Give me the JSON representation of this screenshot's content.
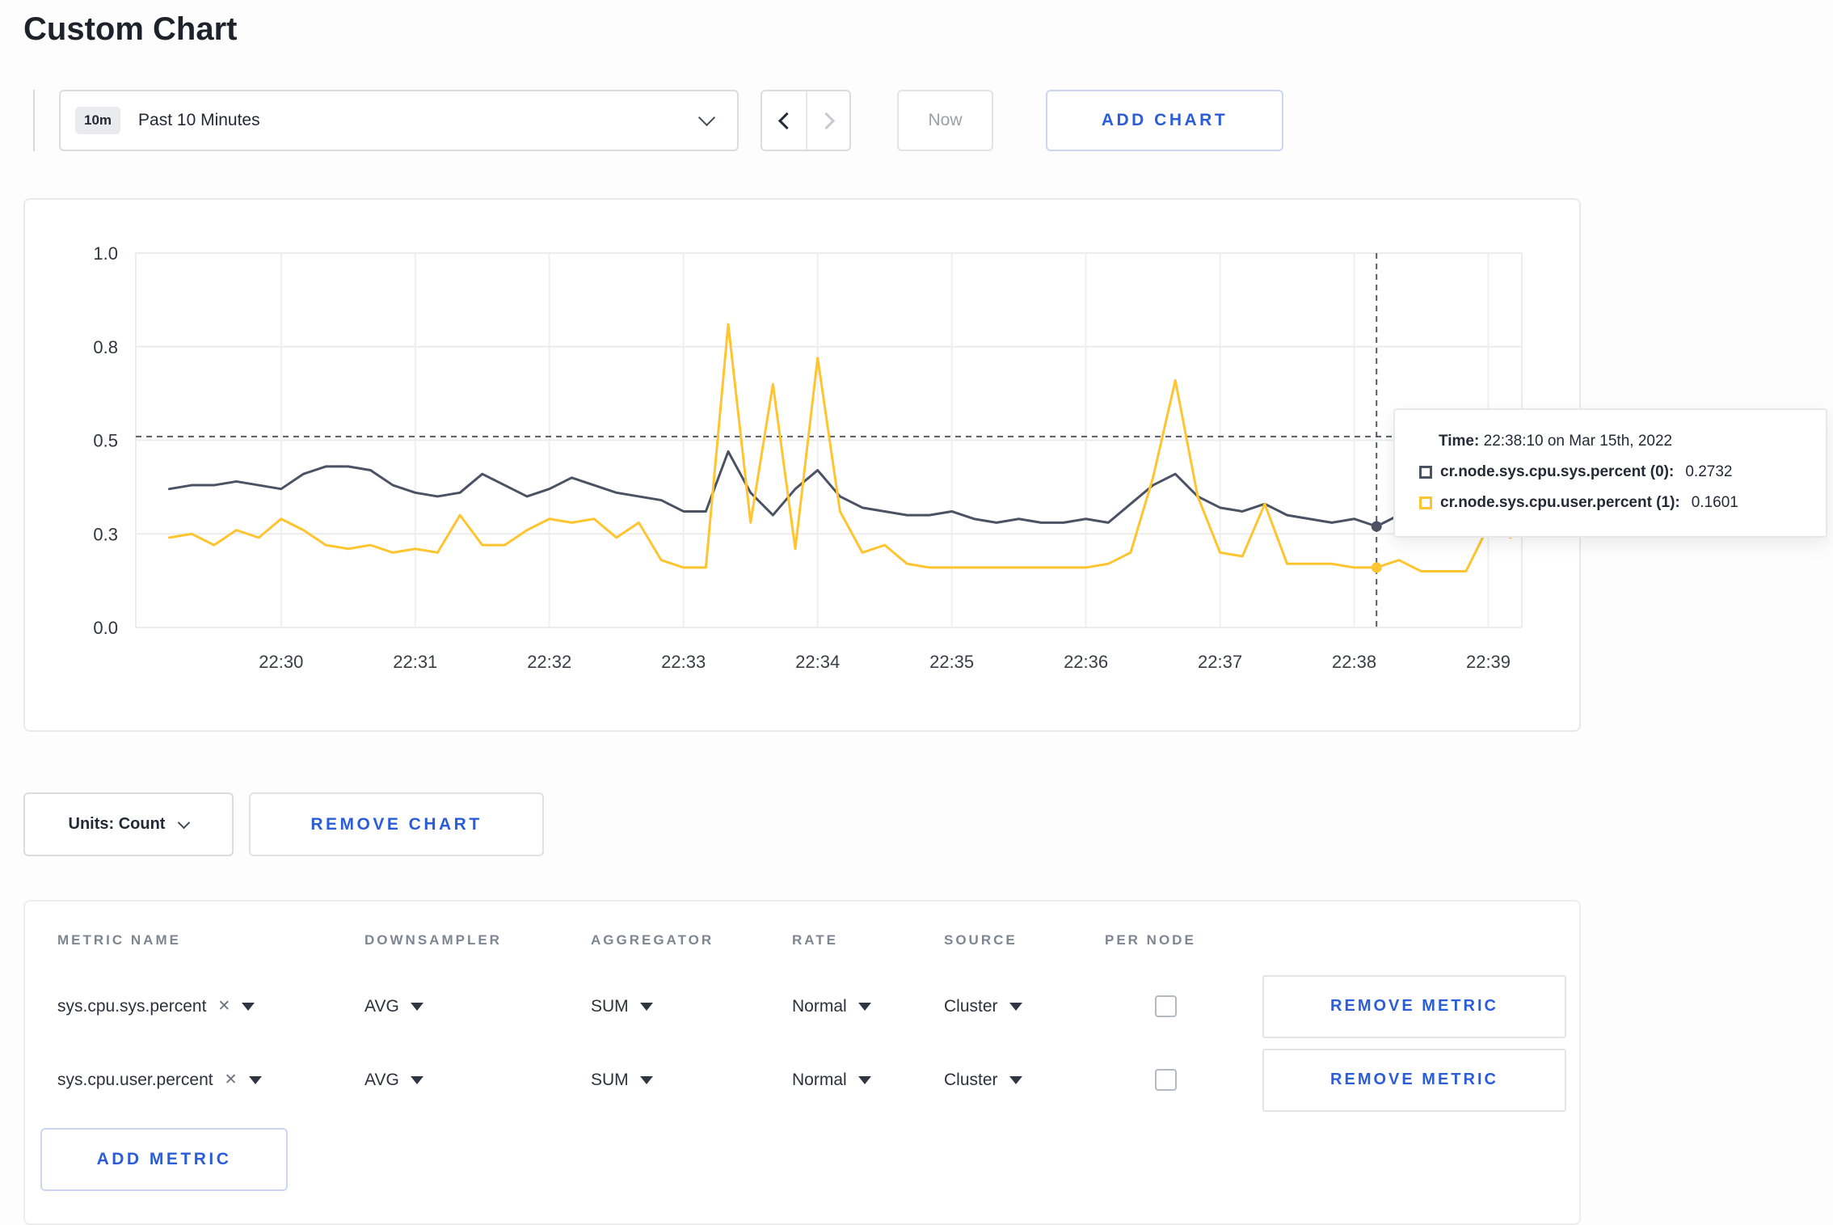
{
  "page": {
    "title": "Custom Chart"
  },
  "toolbar": {
    "time_range": {
      "badge": "10m",
      "label": "Past 10 Minutes"
    },
    "now_label": "Now",
    "add_chart_label": "ADD CHART"
  },
  "chart": {
    "units_label": "Units: Count",
    "remove_chart_label": "REMOVE CHART"
  },
  "tooltip": {
    "time_label": "Time:",
    "time_value": "22:38:10 on Mar 15th, 2022",
    "series": [
      {
        "label": "cr.node.sys.cpu.sys.percent (0):",
        "value": "0.2732"
      },
      {
        "label": "cr.node.sys.cpu.user.percent (1):",
        "value": "0.1601"
      }
    ]
  },
  "metrics_table": {
    "headers": [
      "METRIC NAME",
      "DOWNSAMPLER",
      "AGGREGATOR",
      "RATE",
      "SOURCE",
      "PER NODE"
    ],
    "rows": [
      {
        "metric": "sys.cpu.sys.percent",
        "downsampler": "AVG",
        "aggregator": "SUM",
        "rate": "Normal",
        "source": "Cluster",
        "per_node_checked": false,
        "remove_label": "REMOVE METRIC"
      },
      {
        "metric": "sys.cpu.user.percent",
        "downsampler": "AVG",
        "aggregator": "SUM",
        "rate": "Normal",
        "source": "Cluster",
        "per_node_checked": false,
        "remove_label": "REMOVE METRIC"
      }
    ],
    "add_metric_label": "ADD METRIC"
  },
  "icons": {
    "close": "✕"
  },
  "colors": {
    "accent_blue": "#2b5dd8",
    "series_sys": "#4a5263",
    "series_user": "#ffc530",
    "gridline": "#ececec",
    "crosshair": "#565b64"
  },
  "chart_data": {
    "type": "line",
    "title": "",
    "xlabel": "",
    "ylabel": "",
    "ylim": [
      0,
      1
    ],
    "grid": true,
    "legend_position": "tooltip",
    "x_tick_labels": [
      "22:30",
      "22:31",
      "22:32",
      "22:33",
      "22:34",
      "22:35",
      "22:36",
      "22:37",
      "22:38",
      "22:39"
    ],
    "y_ticks": [
      {
        "value": 0,
        "label": "0.0"
      },
      {
        "value": 0.25,
        "label": "0.3"
      },
      {
        "value": 0.5,
        "label": "0.5"
      },
      {
        "value": 0.75,
        "label": "0.8"
      },
      {
        "value": 1,
        "label": "1.0"
      }
    ],
    "crosshair": {
      "time": "22:38:10",
      "value": 0.51
    },
    "x_times": [
      "22:29:10",
      "22:29:20",
      "22:29:30",
      "22:29:40",
      "22:29:50",
      "22:30:00",
      "22:30:10",
      "22:30:20",
      "22:30:30",
      "22:30:40",
      "22:30:50",
      "22:31:00",
      "22:31:10",
      "22:31:20",
      "22:31:30",
      "22:31:40",
      "22:31:50",
      "22:32:00",
      "22:32:10",
      "22:32:20",
      "22:32:30",
      "22:32:40",
      "22:32:50",
      "22:33:00",
      "22:33:10",
      "22:33:20",
      "22:33:30",
      "22:33:40",
      "22:33:50",
      "22:34:00",
      "22:34:10",
      "22:34:20",
      "22:34:30",
      "22:34:40",
      "22:34:50",
      "22:35:00",
      "22:35:10",
      "22:35:20",
      "22:35:30",
      "22:35:40",
      "22:35:50",
      "22:36:00",
      "22:36:10",
      "22:36:20",
      "22:36:30",
      "22:36:40",
      "22:36:50",
      "22:37:00",
      "22:37:10",
      "22:37:20",
      "22:37:30",
      "22:37:40",
      "22:37:50",
      "22:38:00",
      "22:38:10",
      "22:38:20",
      "22:38:30",
      "22:38:40",
      "22:38:50",
      "22:39:00",
      "22:39:10"
    ],
    "series": [
      {
        "name": "cr.node.sys.cpu.sys.percent",
        "color": "#4a5263",
        "values": [
          0.37,
          0.38,
          0.38,
          0.39,
          0.38,
          0.37,
          0.41,
          0.43,
          0.43,
          0.42,
          0.38,
          0.36,
          0.35,
          0.36,
          0.41,
          0.38,
          0.35,
          0.37,
          0.4,
          0.38,
          0.36,
          0.35,
          0.34,
          0.31,
          0.31,
          0.47,
          0.36,
          0.3,
          0.37,
          0.42,
          0.35,
          0.32,
          0.31,
          0.3,
          0.3,
          0.31,
          0.29,
          0.28,
          0.29,
          0.28,
          0.28,
          0.29,
          0.28,
          0.33,
          0.38,
          0.41,
          0.35,
          0.32,
          0.31,
          0.33,
          0.3,
          0.29,
          0.28,
          0.29,
          0.27,
          0.3,
          0.31,
          0.3,
          0.31,
          0.3,
          0.31
        ]
      },
      {
        "name": "cr.node.sys.cpu.user.percent",
        "color": "#ffc530",
        "values": [
          0.24,
          0.25,
          0.22,
          0.26,
          0.24,
          0.29,
          0.26,
          0.22,
          0.21,
          0.22,
          0.2,
          0.21,
          0.2,
          0.3,
          0.22,
          0.22,
          0.26,
          0.29,
          0.28,
          0.29,
          0.24,
          0.28,
          0.18,
          0.16,
          0.16,
          0.81,
          0.28,
          0.65,
          0.21,
          0.72,
          0.31,
          0.2,
          0.22,
          0.17,
          0.16,
          0.16,
          0.16,
          0.16,
          0.16,
          0.16,
          0.16,
          0.16,
          0.17,
          0.2,
          0.4,
          0.66,
          0.35,
          0.2,
          0.19,
          0.33,
          0.17,
          0.17,
          0.17,
          0.16,
          0.16,
          0.18,
          0.15,
          0.15,
          0.15,
          0.27,
          0.24
        ]
      }
    ]
  }
}
